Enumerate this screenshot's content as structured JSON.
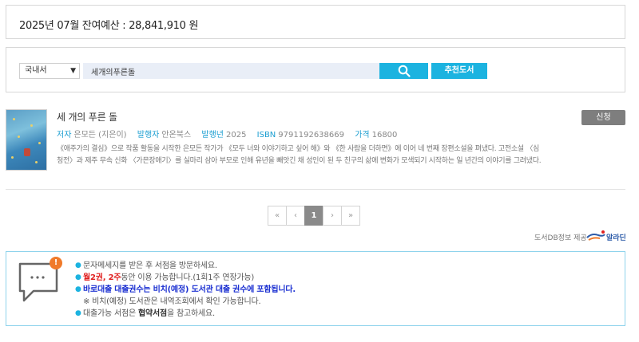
{
  "budget": {
    "text": "2025년 07월 잔여예산 : 28,841,910 원"
  },
  "search": {
    "select_value": "국내서",
    "query": "세개의푸른돌",
    "recommend_label": "추천도서"
  },
  "book": {
    "title": "세 개의 푸른 돌",
    "author_label": "저자",
    "author": "은모든 (지은이)",
    "publisher_label": "발행자",
    "publisher": "안온북스",
    "year_label": "발행년",
    "year": "2025",
    "isbn_label": "ISBN",
    "isbn": "9791192638669",
    "price_label": "가격",
    "price": "16800",
    "description_1": "《애주가의 결심》으로 작품 활동을 시작한 은모든 작가가 《모두 너와 이야기하고 싶어 해》와 《한 사람을 더하면》에 이어 네 번째 장편소설을 펴냈다. 고전소설 〈심",
    "description_2": "청전〉과 제주 무속 신화 〈가믄장애기〉를 실마리 삼아 부모로 인해 유년을 빼앗긴 채 성인이 된 두 친구의 삶에 변화가 모색되기 시작하는 일 년간의 이야기를 그려냈다.",
    "apply_label": "신청"
  },
  "pagination": {
    "first": "«",
    "prev": "‹",
    "current": "1",
    "next": "›",
    "last": "»"
  },
  "provider": {
    "label": "도서DB정보 제공",
    "brand": "알라딘"
  },
  "notice": {
    "alert": "!",
    "bubble_dots": "···",
    "line1": "문자메세지를 받은 후 서점을 방문하세요.",
    "line2_red": "월2권, 2주",
    "line2_rest": "동안 이용 가능합니다.(1회1주 연장가능)",
    "line3": "바로대출 대출권수는 비치(예정) 도서관 대출 권수에 포함됩니다.",
    "line4": "※ 비치(예정) 도서관은 내역조회에서 확인 가능합니다.",
    "line5_pre": "대출가능 서점은 ",
    "line5_bold": "협약서점",
    "line5_post": "을 참고하세요."
  },
  "colors": {
    "accent": "#1cb3e0",
    "alert": "#f07a2a",
    "emphasis_red": "#e02020",
    "emphasis_blue": "#1a2fd1"
  }
}
